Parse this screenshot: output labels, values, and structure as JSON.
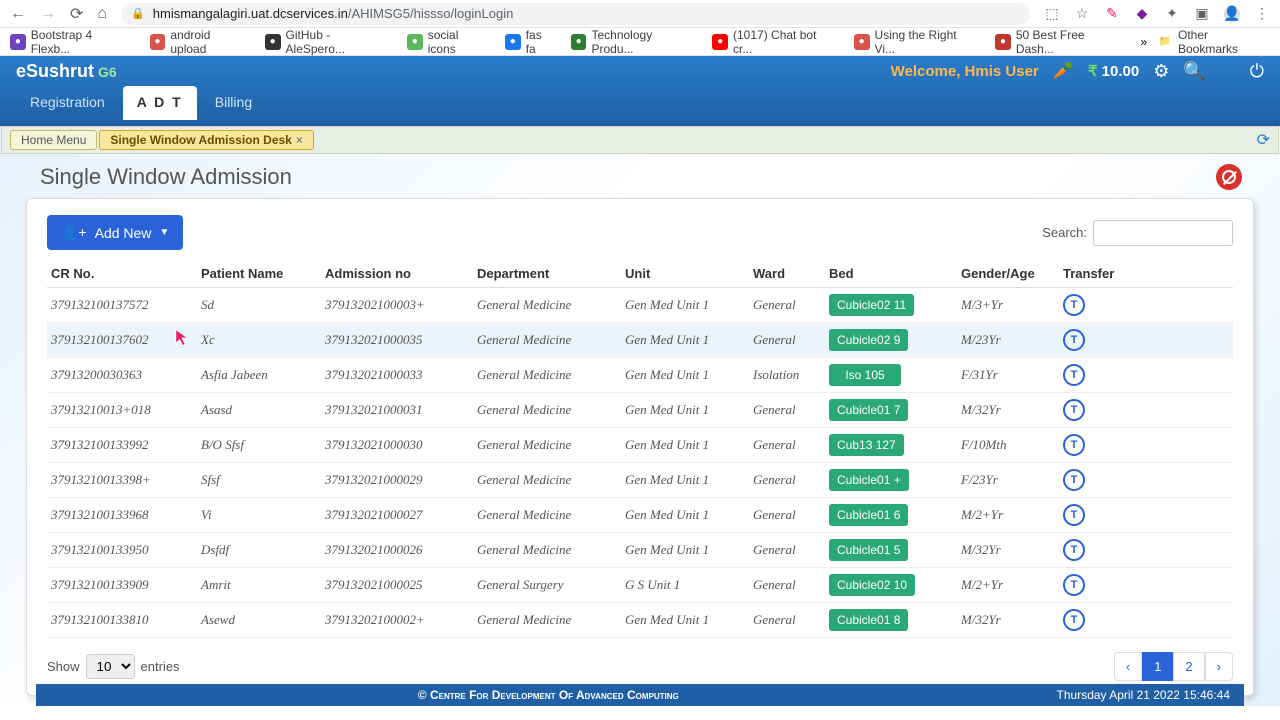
{
  "browser": {
    "url_host": "hmismangalagiri.uat.dcservices.in",
    "url_path": "/AHIMSG5/hissso/loginLogin",
    "bookmarks": [
      {
        "label": "Bootstrap 4 Flexb...",
        "color": "#6f42c1"
      },
      {
        "label": "android upload",
        "color": "#d9534f"
      },
      {
        "label": "GitHub - AleSpero...",
        "color": "#333"
      },
      {
        "label": "social icons",
        "color": "#5cb85c"
      },
      {
        "label": "fas fa",
        "color": "#1877f2"
      },
      {
        "label": "Technology Produ...",
        "color": "#2e7d32"
      },
      {
        "label": "(1017) Chat bot cr...",
        "color": "#ff0000"
      },
      {
        "label": "Using the Right Vi...",
        "color": "#d9534f"
      },
      {
        "label": "50 Best Free Dash...",
        "color": "#c0392b"
      }
    ],
    "other_bookmarks": "Other Bookmarks"
  },
  "header": {
    "brand": "eSushrut",
    "brand_suffix": "G6",
    "welcome": "Welcome, Hmis User",
    "amount": "10.00",
    "tabs": [
      "Registration",
      "A D T",
      "Billing"
    ],
    "active_tab": 1
  },
  "subtabs": {
    "home": "Home Menu",
    "active": "Single Window Admission Desk"
  },
  "page": {
    "title": "Single Window Admission",
    "add_new": "Add New",
    "search_label": "Search:",
    "show_label": "Show",
    "entries_label": "entries",
    "show_value": "10",
    "pages": [
      "1",
      "2"
    ],
    "active_page": 0
  },
  "table": {
    "headers": [
      "CR No.",
      "Patient Name",
      "Admission no",
      "Department",
      "Unit",
      "Ward",
      "Bed",
      "Gender/Age",
      "Transfer"
    ],
    "rows": [
      {
        "cr": "379132100137572",
        "name": "Sd",
        "adm": "37913202100003+",
        "dep": "General Medicine",
        "unit": "Gen Med Unit 1",
        "ward": "General",
        "bed": "Cubicle02 11",
        "ga": "M/3+Yr"
      },
      {
        "cr": "379132100137602",
        "name": "Xc",
        "adm": "379132021000035",
        "dep": "General Medicine",
        "unit": "Gen Med Unit 1",
        "ward": "General",
        "bed": "Cubicle02 9",
        "ga": "M/23Yr",
        "hover": true
      },
      {
        "cr": "37913200030363",
        "name": "Asfia Jabeen",
        "adm": "379132021000033",
        "dep": "General Medicine",
        "unit": "Gen Med Unit 1",
        "ward": "Isolation",
        "bed": "Iso 105",
        "ga": "F/31Yr"
      },
      {
        "cr": "37913210013+018",
        "name": "Asasd",
        "adm": "379132021000031",
        "dep": "General Medicine",
        "unit": "Gen Med Unit 1",
        "ward": "General",
        "bed": "Cubicle01 7",
        "ga": "M/32Yr"
      },
      {
        "cr": "379132100133992",
        "name": "B/O Sfsf",
        "adm": "379132021000030",
        "dep": "General Medicine",
        "unit": "Gen Med Unit 1",
        "ward": "General",
        "bed": "Cub13 127",
        "ga": "F/10Mth"
      },
      {
        "cr": "37913210013398+",
        "name": "Sfsf",
        "adm": "379132021000029",
        "dep": "General Medicine",
        "unit": "Gen Med Unit 1",
        "ward": "General",
        "bed": "Cubicle01 +",
        "ga": "F/23Yr"
      },
      {
        "cr": "379132100133968",
        "name": "Vi",
        "adm": "379132021000027",
        "dep": "General Medicine",
        "unit": "Gen Med Unit 1",
        "ward": "General",
        "bed": "Cubicle01 6",
        "ga": "M/2+Yr"
      },
      {
        "cr": "379132100133950",
        "name": "Dsfdf",
        "adm": "379132021000026",
        "dep": "General Medicine",
        "unit": "Gen Med Unit 1",
        "ward": "General",
        "bed": "Cubicle01 5",
        "ga": "M/32Yr"
      },
      {
        "cr": "379132100133909",
        "name": "Amrit",
        "adm": "379132021000025",
        "dep": "General Surgery",
        "unit": "G S Unit 1",
        "ward": "General",
        "bed": "Cubicle02 10",
        "ga": "M/2+Yr"
      },
      {
        "cr": "379132100133810",
        "name": "Asewd",
        "adm": "37913202100002+",
        "dep": "General Medicine",
        "unit": "Gen Med Unit 1",
        "ward": "General",
        "bed": "Cubicle01 8",
        "ga": "M/32Yr"
      }
    ]
  },
  "footer": {
    "copyright": "© Centre For Development Of Advanced Computing",
    "timestamp": "Thursday April 21 2022 15:46:44"
  }
}
